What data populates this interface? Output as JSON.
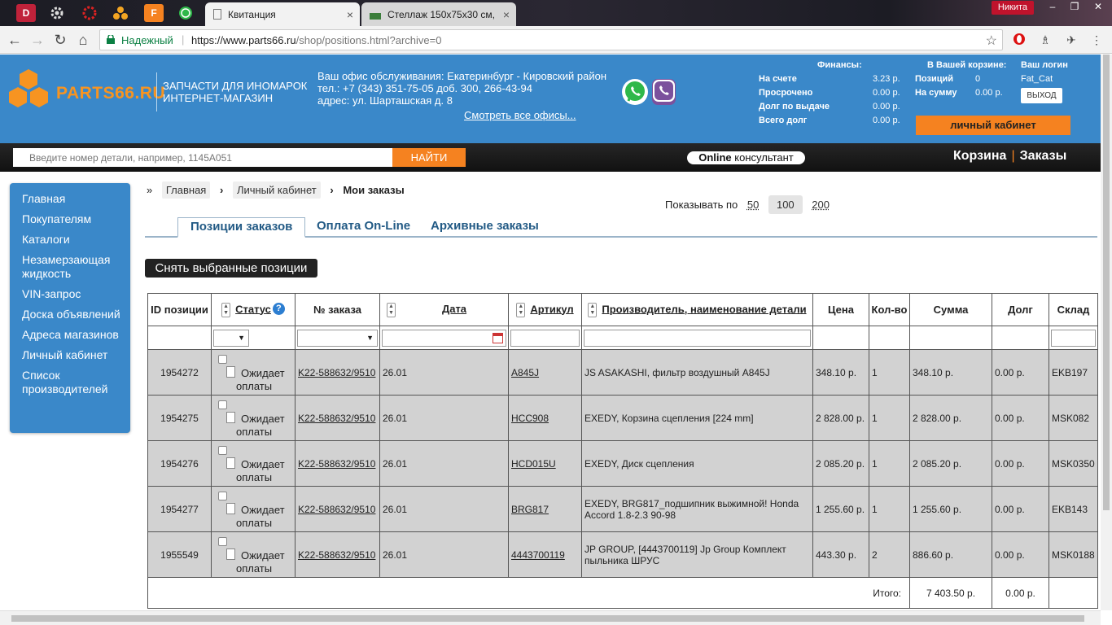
{
  "browser": {
    "tabs": [
      {
        "title": "Квитанция",
        "active": true
      },
      {
        "title": "Стеллаж 150х75х30 см,",
        "active": false
      }
    ],
    "user_chip": "Никита",
    "secure_label": "Надежный",
    "url_host": "https://www.parts66.ru",
    "url_path": "/shop/positions.html?archive=0",
    "pinned": [
      "D",
      "F"
    ]
  },
  "header": {
    "logo": "PARTS66.RU",
    "tagline_1": "ЗАПЧАСТИ ДЛЯ ИНОМАРОК",
    "tagline_2": "ИНТЕРНЕТ-МАГАЗИН",
    "office_line": "Ваш офис обслуживания: Екатеринбург - Кировский район",
    "phone_line": "тел.: +7 (343) 351-75-05 доб. 300, 266-43-94",
    "address_line": "адрес: ул. Шарташская д. 8",
    "offices_link": "Смотреть все офисы...",
    "finance": {
      "title": "Финансы:",
      "rows": [
        {
          "label": "На счете",
          "value": "3.23 р."
        },
        {
          "label": "Просрочено",
          "value": "0.00 р."
        },
        {
          "label": "Долг по выдаче",
          "value": "0.00 р."
        },
        {
          "label": "Всего долг",
          "value": "0.00 р."
        }
      ]
    },
    "cart": {
      "title": "В Вашей корзине:",
      "rows": [
        {
          "label": "Позиций",
          "value": "0"
        },
        {
          "label": "На сумму",
          "value": "0.00 р."
        }
      ]
    },
    "login": {
      "title": "Ваш логин",
      "name": "Fat_Cat",
      "logout": "ВЫХОД"
    },
    "cabinet_button": "личный кабинет"
  },
  "searchbar": {
    "placeholder": "Введите номер детали, например, 1145A051",
    "button": "НАЙТИ",
    "consult_bold": "Online",
    "consult_rest": " консультант",
    "cart_link": "Корзина",
    "orders_link": "Заказы"
  },
  "sidebar": {
    "items": [
      "Главная",
      "Покупателям",
      "Каталоги",
      "Незамерзающая жидкость",
      "VIN-запрос",
      "Доска объявлений",
      "Адреса магазинов",
      "Личный кабинет",
      "Список производителей"
    ]
  },
  "breadcrumb": {
    "home": "Главная",
    "cabinet": "Личный кабинет",
    "current": "Мои заказы",
    "prefix": "»",
    "sep": "›"
  },
  "perpage": {
    "label": "Показывать по",
    "options": [
      "50",
      "100",
      "200"
    ]
  },
  "tabs": [
    "Позиции заказов",
    "Оплата On-Line",
    "Архивные заказы"
  ],
  "remove_button": "Снять выбранные позиции",
  "table": {
    "headers": {
      "id": "ID позиции",
      "status": "Статус",
      "order": "№ заказа",
      "date": "Дата",
      "article": "Артикул",
      "maker": "Производитель, наименование детали",
      "price": "Цена",
      "qty": "Кол-во",
      "sum": "Сумма",
      "debt": "Долг",
      "warehouse": "Склад"
    },
    "status_line1": "Ожидает",
    "status_line2": "оплаты",
    "rows": [
      {
        "id": "1954272",
        "order": "K22-588632/9510",
        "date": "26.01",
        "article": "A845J",
        "name": "JS ASAKASHI, фильтр воздушный A845J",
        "price": "348.10 р.",
        "qty": "1",
        "sum": "348.10 р.",
        "debt": "0.00 р.",
        "warehouse": "EKB197"
      },
      {
        "id": "1954275",
        "order": "K22-588632/9510",
        "date": "26.01",
        "article": "HCC908",
        "name": "EXEDY, Корзина сцепления [224 mm]",
        "price": "2 828.00 р.",
        "qty": "1",
        "sum": "2 828.00 р.",
        "debt": "0.00 р.",
        "warehouse": "MSK082"
      },
      {
        "id": "1954276",
        "order": "K22-588632/9510",
        "date": "26.01",
        "article": "HCD015U",
        "name": "EXEDY, Диск сцепления",
        "price": "2 085.20 р.",
        "qty": "1",
        "sum": "2 085.20 р.",
        "debt": "0.00 р.",
        "warehouse": "MSK0350"
      },
      {
        "id": "1954277",
        "order": "K22-588632/9510",
        "date": "26.01",
        "article": "BRG817",
        "name": "EXEDY, BRG817_подшипник выжимной! Honda Accord 1.8-2.3 90-98",
        "price": "1 255.60 р.",
        "qty": "1",
        "sum": "1 255.60 р.",
        "debt": "0.00 р.",
        "warehouse": "EKB143"
      },
      {
        "id": "1955549",
        "order": "K22-588632/9510",
        "date": "26.01",
        "article": "4443700119",
        "name": "JP GROUP, [4443700119] Jp Group Комплект пыльника ШРУС",
        "price": "443.30 р.",
        "qty": "2",
        "sum": "886.60 р.",
        "debt": "0.00 р.",
        "warehouse": "MSK0188"
      }
    ],
    "total_label": "Итого:",
    "total_sum": "7 403.50 р.",
    "total_debt": "0.00 р."
  }
}
